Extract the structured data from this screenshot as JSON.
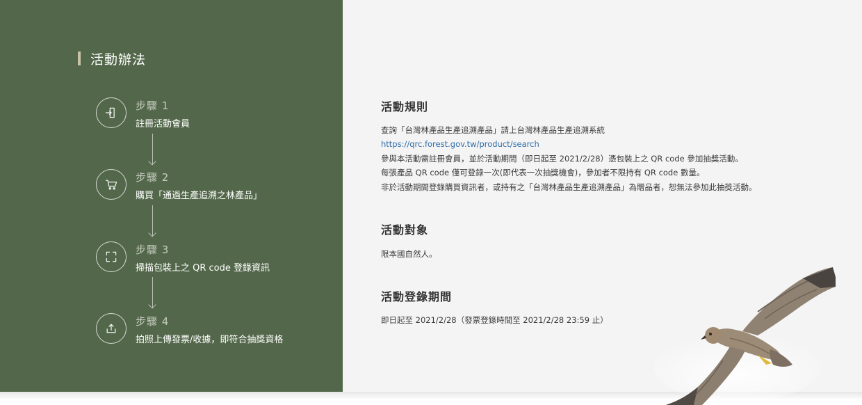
{
  "sidebar": {
    "title": "活動辦法",
    "steps": [
      {
        "label": "步驟 1",
        "desc": "註冊活動會員",
        "icon": "login-icon"
      },
      {
        "label": "步驟 2",
        "desc": "購買「通過生產追溯之林產品」",
        "icon": "cart-icon"
      },
      {
        "label": "步驟 3",
        "desc": "掃描包裝上之 QR code 登錄資訊",
        "icon": "scan-icon"
      },
      {
        "label": "步驟 4",
        "desc": "拍照上傳發票/收據，即符合抽獎資格",
        "icon": "upload-icon"
      }
    ]
  },
  "rules": {
    "title": "活動規則",
    "line1": "查詢「台灣林產品生產追溯產品」請上台灣林產品生產追溯系統",
    "link": "https://qrc.forest.gov.tw/product/search",
    "line3": "參與本活動需註冊會員，並於活動期間（即日起至 2021/2/28）憑包裝上之 QR code 參加抽獎活動。",
    "line4": "每張產品 QR code 僅可登錄一次(即代表一次抽獎機會)，參加者不限持有 QR code 數量。",
    "line5": "非於活動期間登錄購買資訊者，或持有之「台灣林產品生產追溯產品」為贈品者，恕無法參加此抽獎活動。"
  },
  "target": {
    "title": "活動對象",
    "text": "限本國自然人。"
  },
  "period": {
    "title": "活動登錄期間",
    "text": "即日起至 2021/2/28（發票登錄時間至 2021/2/28 23:59 止）"
  },
  "colors": {
    "panel_green": "#53684a",
    "accent_bar": "#c9c3a8",
    "link_blue": "#2f6da8"
  }
}
